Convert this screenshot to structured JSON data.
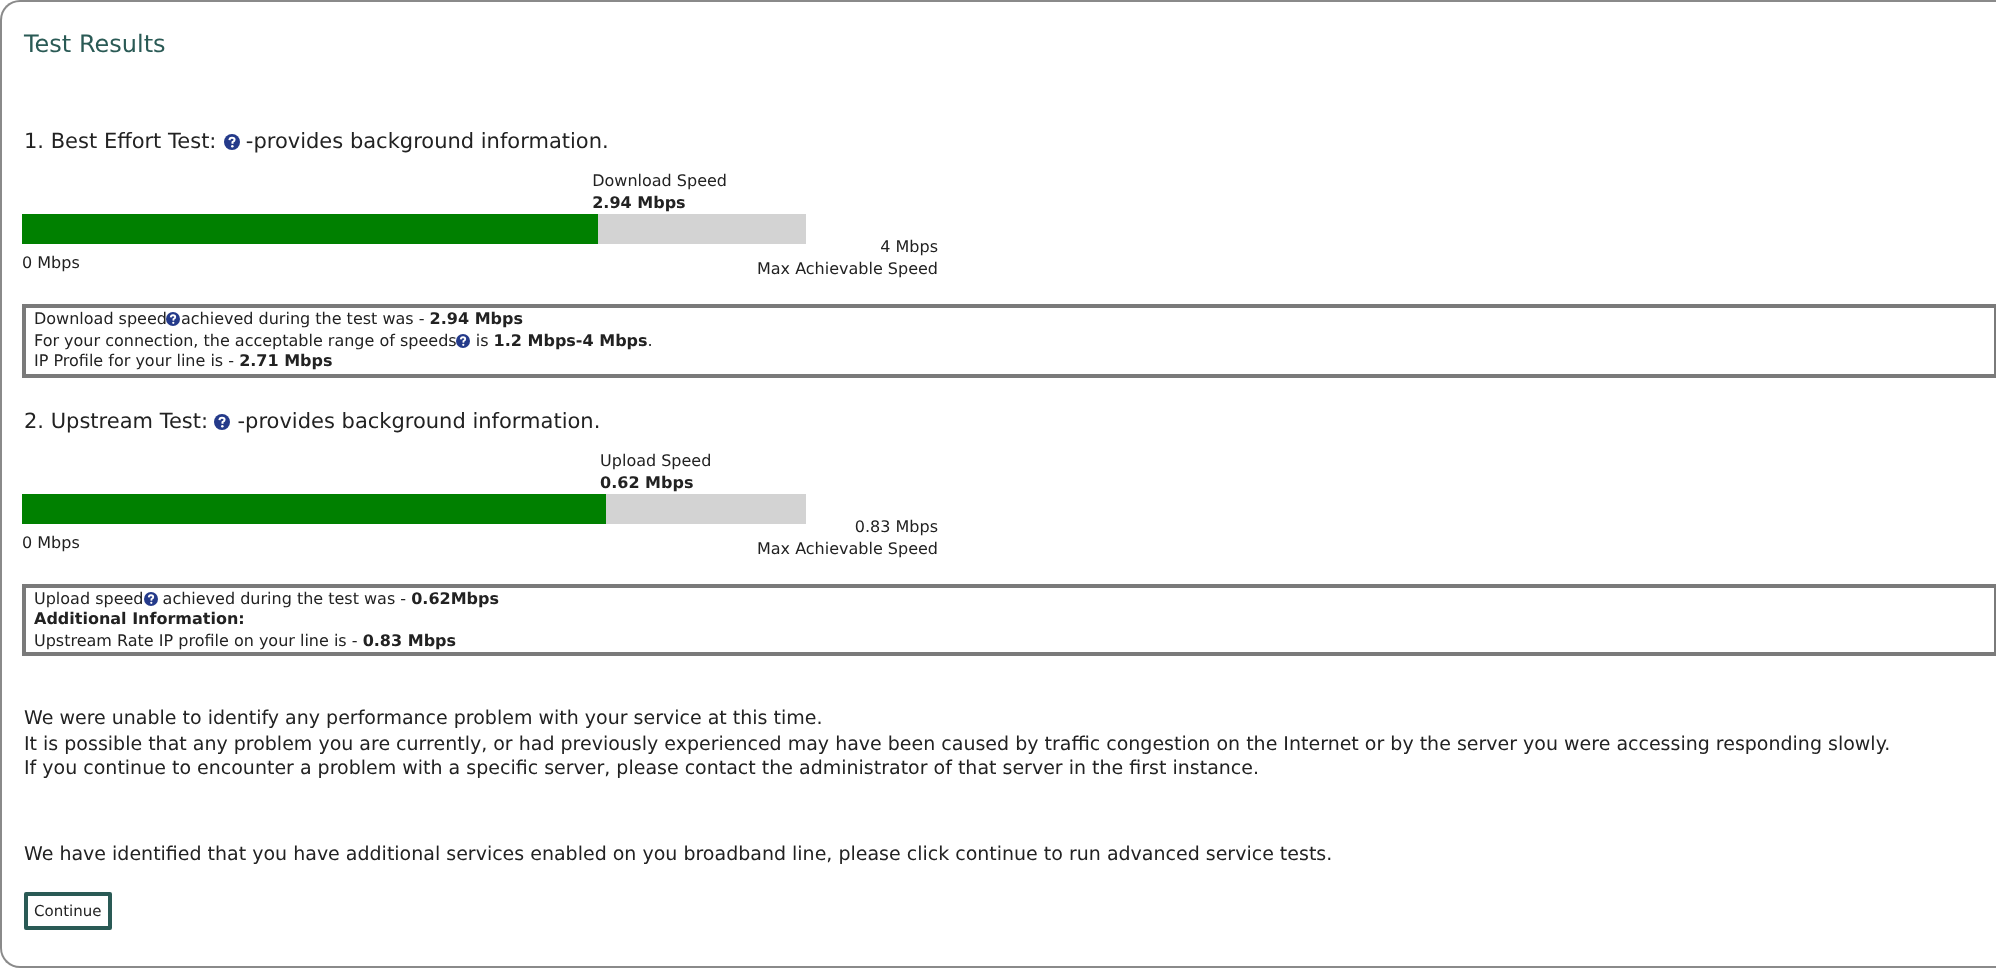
{
  "title": "Test Results",
  "tests": [
    {
      "heading": "1. Best Effort Test:",
      "heading_after": "-provides background information.",
      "speed_label": "Download  Speed",
      "speed_value": "2.94 Mbps",
      "level": 0.735,
      "min_label": "0 Mbps",
      "max_value": "4 Mbps",
      "max_label": "Max Achievable Speed",
      "info": [
        {
          "before": "Download speed",
          "help_icon": true,
          "after": "achieved during the test was - **2.94 Mbps**",
          "bold": false
        },
        {
          "before": "For your connection, the acceptable range of speeds",
          "help_icon": true,
          "after": " is **1.2 Mbps-4 Mbps**.",
          "bold": false
        },
        {
          "before": "IP Profile for your line is - **2.71 Mbps**",
          "help_icon": false,
          "bold": false
        }
      ]
    },
    {
      "heading": "2. Upstream Test:",
      "heading_after": "-provides background information.",
      "speed_label": "Upload Speed",
      "speed_value": "0.62 Mbps",
      "level": 0.745,
      "min_label": "0 Mbps",
      "max_value": "0.83 Mbps",
      "max_label": "Max Achievable Speed",
      "info": [
        {
          "before": "Upload speed",
          "help_icon": true,
          "after": " achieved during the test was - **0.62Mbps**",
          "bold": false
        },
        {
          "before": "Additional Information:",
          "help_icon": false,
          "bold": true
        },
        {
          "before": "Upstream Rate IP profile on your line is - **0.83 Mbps**",
          "help_icon": false,
          "bold": false
        }
      ]
    }
  ],
  "message_lines": [
    "We were unable to identify any performance problem with your service at this time.",
    "It is possible that any problem you are currently, or had previously experienced may have been caused by traffic congestion on the Internet or by the server you were accessing responding slowly.",
    "If you continue to encounter a problem with a specific server, please contact the administrator of that server in the first instance."
  ],
  "additional_services": "We have identified that you have additional services enabled on you broadband line, please click continue to run advanced service tests.",
  "button": "Continue"
}
